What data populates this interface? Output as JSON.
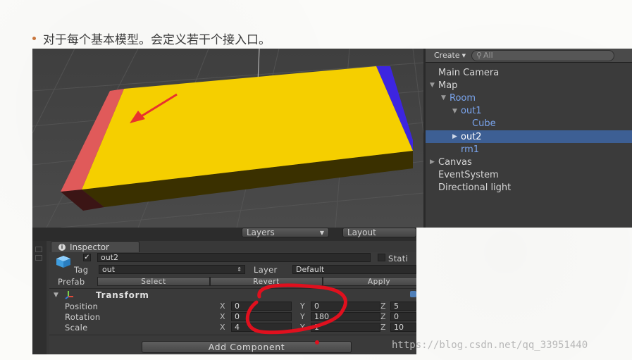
{
  "slide": {
    "bullet_text": "对于每个基本模型。会定义若干个接入口。",
    "bullet_color": "#c8753c"
  },
  "scene_view": {
    "colors": {
      "background": "#434343",
      "top_face": "#f5cf00",
      "front_face": "#3a3000",
      "left_end": "#e05a5a",
      "right_end": "#3d25e0",
      "arrow": "#e8322e"
    }
  },
  "hierarchy": {
    "create_label": "Create",
    "search_placeholder": "All",
    "items": [
      {
        "label": "Main Camera",
        "indent": 0,
        "expander": "none",
        "color": "normal",
        "selected": false
      },
      {
        "label": "Map",
        "indent": 0,
        "expander": "open",
        "color": "normal",
        "selected": false
      },
      {
        "label": "Room",
        "indent": 1,
        "expander": "open",
        "color": "blue",
        "selected": false
      },
      {
        "label": "out1",
        "indent": 2,
        "expander": "open",
        "color": "blue",
        "selected": false
      },
      {
        "label": "Cube",
        "indent": 3,
        "expander": "none",
        "color": "blue",
        "selected": false
      },
      {
        "label": "out2",
        "indent": 2,
        "expander": "closed",
        "color": "normal",
        "selected": true
      },
      {
        "label": "rm1",
        "indent": 2,
        "expander": "none",
        "color": "blue",
        "selected": false
      },
      {
        "label": "Canvas",
        "indent": 0,
        "expander": "closed",
        "color": "normal",
        "selected": false
      },
      {
        "label": "EventSystem",
        "indent": 0,
        "expander": "none",
        "color": "normal",
        "selected": false
      },
      {
        "label": "Directional light",
        "indent": 0,
        "expander": "none",
        "color": "normal",
        "selected": false
      }
    ]
  },
  "editor_toolbar": {
    "layers_label": "Layers",
    "layout_label": "Layout"
  },
  "inspector": {
    "tab_label": "Inspector",
    "object_name": "out2",
    "active_checked": true,
    "static_label": "Stati",
    "tag_label": "Tag",
    "tag_value": "out",
    "layer_label": "Layer",
    "layer_value": "Default",
    "prefab_label": "Prefab",
    "prefab_buttons": [
      "Select",
      "Revert",
      "Apply"
    ],
    "transform": {
      "title": "Transform",
      "rows": [
        {
          "label": "Position",
          "x": "0",
          "y": "0",
          "z": "5"
        },
        {
          "label": "Rotation",
          "x": "0",
          "y": "180",
          "z": "0"
        },
        {
          "label": "Scale",
          "x": "4",
          "y": "1",
          "z": "10"
        }
      ],
      "axis_labels": [
        "X",
        "Y",
        "Z"
      ]
    },
    "add_component_label": "Add Component"
  },
  "annotation": {
    "circle_color": "#e0101e"
  },
  "watermark": "https://blog.csdn.net/qq_33951440"
}
